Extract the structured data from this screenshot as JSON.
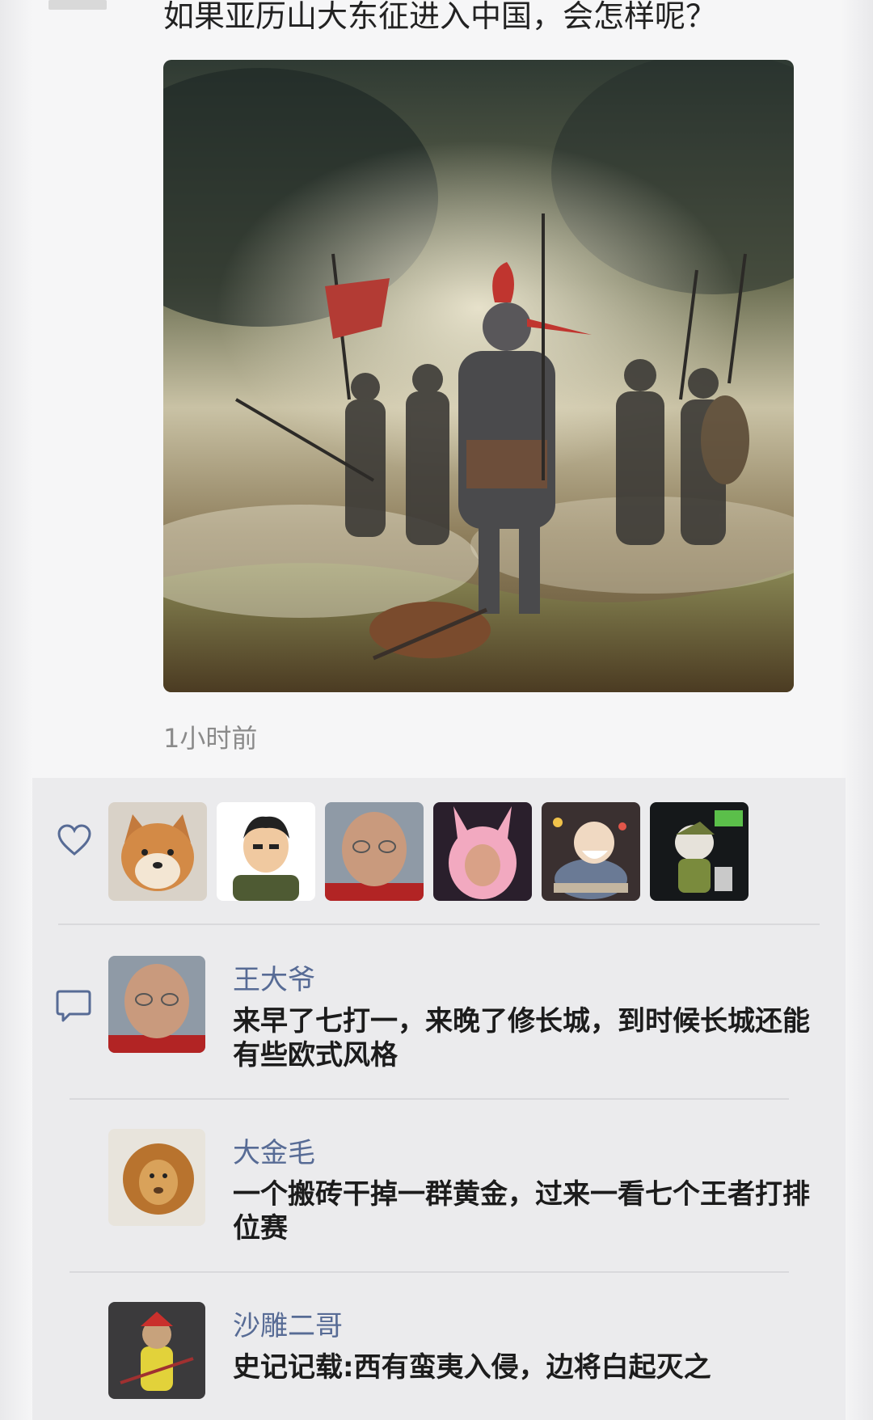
{
  "post": {
    "text": "如果亚历山大东征进入中国，会怎样呢？",
    "image_icon": "battle-painting-image",
    "time": "1小时前"
  },
  "likes": {
    "icon": "heart-icon",
    "avatars": [
      {
        "name": "shiba-dog-avatar"
      },
      {
        "name": "cartoon-man-avatar"
      },
      {
        "name": "old-man-avatar"
      },
      {
        "name": "pink-bunny-costume-avatar"
      },
      {
        "name": "cartoon-chef-avatar"
      },
      {
        "name": "cat-figure-avatar"
      }
    ]
  },
  "comments": {
    "icon": "comment-bubble-icon",
    "items": [
      {
        "author": "王大爷",
        "text": "来早了七打一，来晚了修长城，到时候长城还能有些欧式风格",
        "avatar": "old-man-avatar"
      },
      {
        "author": "大金毛",
        "text": "一个搬砖干掉一群黄金，过来一看七个王者打排位赛",
        "avatar": "lion-avatar"
      },
      {
        "author": "沙雕二哥",
        "text": "史记记载:西有蛮夷入侵，边将白起灭之",
        "avatar": "warrior-figure-avatar"
      }
    ]
  },
  "colors": {
    "name_link": "#576b95",
    "time_gray": "#8a8a8a",
    "panel_bg": "#ebebed"
  }
}
